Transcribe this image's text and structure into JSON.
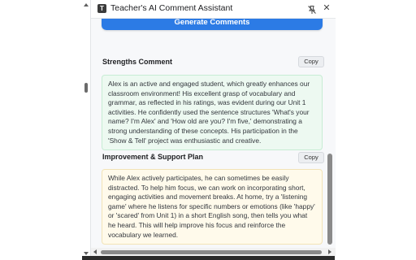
{
  "window": {
    "title": "Teacher's AI Comment Assistant",
    "app_icon_glyph": "T",
    "pin_icon": "pin-icon",
    "close_icon": "close-icon",
    "close_glyph": "✕"
  },
  "actions": {
    "generate_label": "Generate Comments"
  },
  "strengths": {
    "title": "Strengths Comment",
    "copy_label": "Copy",
    "text": "Alex is an active and engaged student, which greatly enhances our classroom environment! His excellent grasp of vocabulary and grammar, as reflected in his ratings, was evident during our Unit 1 activities. He confidently used the sentence structures 'What's your name? I'm Alex' and 'How old are you? I'm five,' demonstrating a strong understanding of these concepts. His participation in the 'Show & Tell' project was enthusiastic and creative."
  },
  "improvement": {
    "title": "Improvement & Support Plan",
    "copy_label": "Copy",
    "text": "While Alex actively participates, he can sometimes be easily distracted. To help him focus, we can work on incorporating short, engaging activities and movement breaks. At home, try a 'listening game' where he listens for specific numbers or emotions (like 'happy' or 'scared' from Unit 1) in a short English song, then tells you what he heard. This will help improve his focus and reinforce the vocabulary we learned."
  },
  "colors": {
    "primary_button": "#2c7be5",
    "strengths_bg": "#edf9f1",
    "improvement_bg": "#fffaeb"
  }
}
